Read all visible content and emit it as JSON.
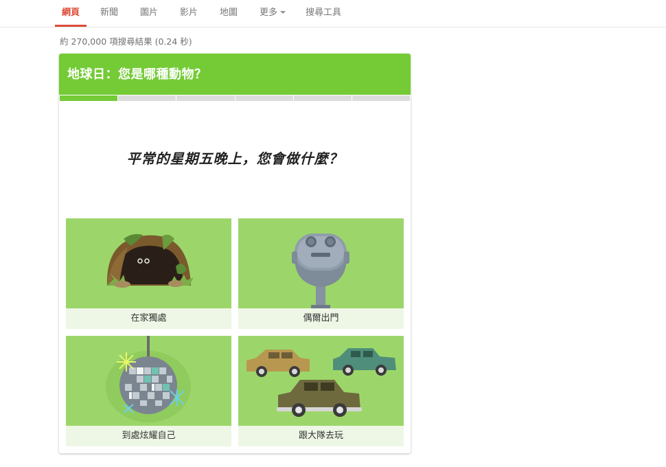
{
  "nav": {
    "tabs": [
      {
        "label": "網頁",
        "active": true
      },
      {
        "label": "新聞"
      },
      {
        "label": "圖片"
      },
      {
        "label": "影片"
      },
      {
        "label": "地圖"
      },
      {
        "label": "更多",
        "has_dropdown": true
      },
      {
        "label": "搜尋工具"
      }
    ]
  },
  "result_stats": "約 270,000 項搜尋結果 (0.24 秒)",
  "quiz": {
    "title": "地球日：您是哪種動物？",
    "progress": {
      "total_steps": 6,
      "current_step": 1
    },
    "question": "平常的星期五晚上，您會做什麼？",
    "options": [
      {
        "label": "在家獨處",
        "icon": "cave-icon"
      },
      {
        "label": "偶爾出門",
        "icon": "binocular-viewer-icon"
      },
      {
        "label": "到處炫耀自己",
        "icon": "disco-ball-icon"
      },
      {
        "label": "跟大隊去玩",
        "icon": "cars-icon"
      }
    ]
  },
  "colors": {
    "accent_red": "#dd4b39",
    "quiz_green": "#74cb36",
    "option_green": "#9cd66a",
    "option_label_bg": "#eef7e6"
  }
}
